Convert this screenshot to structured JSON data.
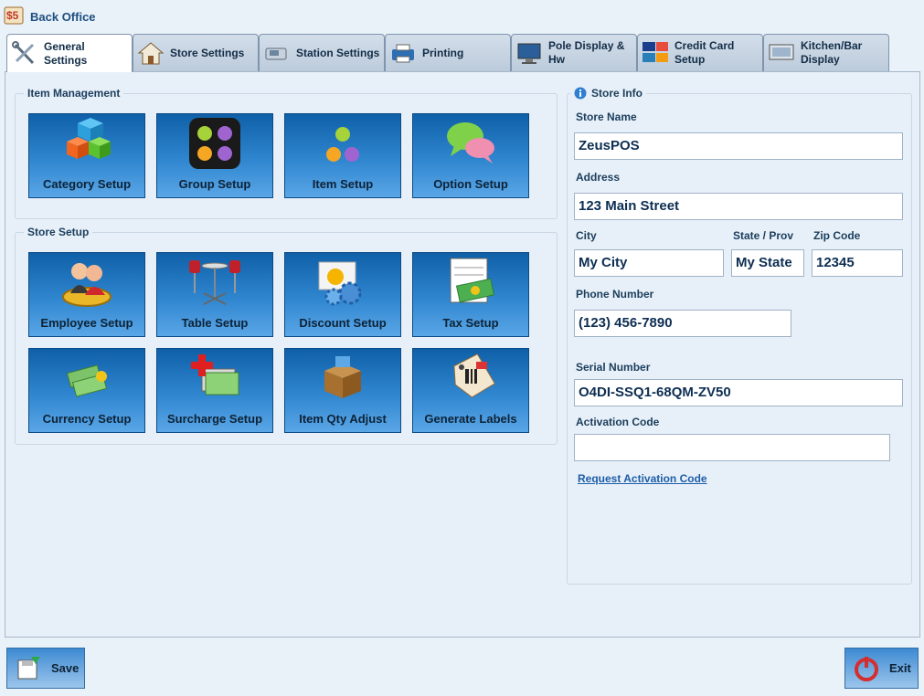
{
  "app": {
    "title": "Back Office",
    "logo_text": "$5"
  },
  "tabs": [
    {
      "line1": "General",
      "line2": "Settings",
      "icon": "tools-icon"
    },
    {
      "line1": "Store Settings",
      "line2": "",
      "icon": "house-icon"
    },
    {
      "line1": "Station Settings",
      "line2": "",
      "icon": "station-icon"
    },
    {
      "line1": "Printing",
      "line2": "",
      "icon": "printer-icon"
    },
    {
      "line1": "Pole Display &",
      "line2": "Hw",
      "icon": "monitor-icon"
    },
    {
      "line1": "Credit Card",
      "line2": "Setup",
      "icon": "credit-card-icon"
    },
    {
      "line1": "Kitchen/Bar",
      "line2": "Display",
      "icon": "kitchen-display-icon"
    }
  ],
  "item_management": {
    "title": "Item Management",
    "tiles": [
      {
        "label": "Category Setup",
        "icon": "cubes-icon"
      },
      {
        "label": "Group Setup",
        "icon": "dots-grid-icon"
      },
      {
        "label": "Item Setup",
        "icon": "dots-icon"
      },
      {
        "label": "Option Setup",
        "icon": "chat-bubbles-icon"
      }
    ]
  },
  "store_setup": {
    "title": "Store Setup",
    "tiles": [
      {
        "label": "Employee Setup",
        "icon": "employees-icon"
      },
      {
        "label": "Table Setup",
        "icon": "table-chairs-icon"
      },
      {
        "label": "Discount Setup",
        "icon": "discount-gears-icon"
      },
      {
        "label": "Tax Setup",
        "icon": "money-calendar-icon"
      },
      {
        "label": "Currency Setup",
        "icon": "currency-icon"
      },
      {
        "label": "Surcharge Setup",
        "icon": "surcharge-icon"
      },
      {
        "label": "Item Qty Adjust",
        "icon": "box-icon"
      },
      {
        "label": "Generate Labels",
        "icon": "price-tag-icon"
      }
    ]
  },
  "store_info": {
    "title": "Store Info",
    "store_name_label": "Store Name",
    "store_name": "ZeusPOS",
    "address_label": "Address",
    "address": "123 Main Street",
    "city_label": "City",
    "city": "My City",
    "state_label": "State / Prov",
    "state": "My State",
    "zip_label": "Zip Code",
    "zip": "12345",
    "phone_label": "Phone Number",
    "phone": "(123) 456-7890",
    "serial_label": "Serial Number",
    "serial": "O4DI-SSQ1-68QM-ZV50",
    "activation_label": "Activation Code",
    "activation": "",
    "request_link": "Request Activation Code"
  },
  "footer": {
    "save_label": "Save",
    "exit_label": "Exit"
  },
  "colors": {
    "tile_top": "#0f60a8",
    "tile_bottom": "#5aa6e6",
    "text_dark": "#0d2e52"
  }
}
